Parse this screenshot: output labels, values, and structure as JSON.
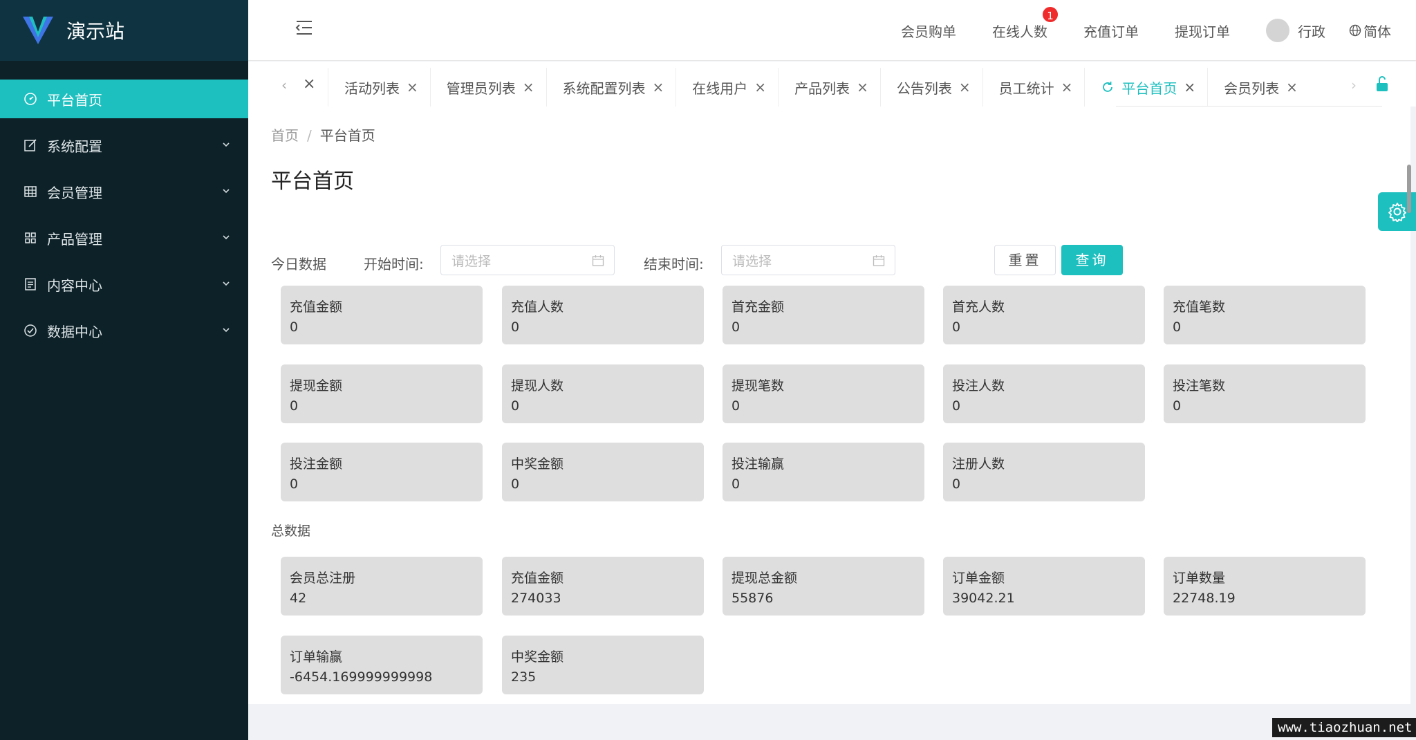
{
  "app": {
    "title": "演示站"
  },
  "sidebar": {
    "items": [
      {
        "label": "平台首页",
        "icon": "dashboard-icon",
        "active": true
      },
      {
        "label": "系统配置",
        "icon": "edit-icon"
      },
      {
        "label": "会员管理",
        "icon": "table-icon"
      },
      {
        "label": "产品管理",
        "icon": "grid-icon"
      },
      {
        "label": "内容中心",
        "icon": "document-icon"
      },
      {
        "label": "数据中心",
        "icon": "check-circle-icon"
      }
    ]
  },
  "header": {
    "links": [
      "会员购单",
      "在线人数",
      "充值订单",
      "提现订单"
    ],
    "online_badge": "1",
    "user_name": "行政",
    "language": "简体"
  },
  "tabs": {
    "items": [
      {
        "label": "活动列表"
      },
      {
        "label": "管理员列表"
      },
      {
        "label": "系统配置列表"
      },
      {
        "label": "在线用户"
      },
      {
        "label": "产品列表"
      },
      {
        "label": "公告列表"
      },
      {
        "label": "员工统计"
      },
      {
        "label": "平台首页",
        "active": true
      },
      {
        "label": "会员列表"
      }
    ],
    "close_glyph": "×"
  },
  "breadcrumb": {
    "home": "首页",
    "separator": "/",
    "current": "平台首页"
  },
  "page_title": "平台首页",
  "filter": {
    "today_label": "今日数据",
    "start_label": "开始时间:",
    "start_placeholder": "请选择",
    "end_label": "结束时间:",
    "end_placeholder": "请选择",
    "reset_label": "重置",
    "query_label": "查询"
  },
  "today_stats": [
    {
      "label": "充值金额",
      "value": "0"
    },
    {
      "label": "充值人数",
      "value": "0"
    },
    {
      "label": "首充金额",
      "value": "0"
    },
    {
      "label": "首充人数",
      "value": "0"
    },
    {
      "label": "充值笔数",
      "value": "0"
    },
    {
      "label": "提现金额",
      "value": "0"
    },
    {
      "label": "提现人数",
      "value": "0"
    },
    {
      "label": "提现笔数",
      "value": "0"
    },
    {
      "label": "投注人数",
      "value": "0"
    },
    {
      "label": "投注笔数",
      "value": "0"
    },
    {
      "label": "投注金额",
      "value": "0"
    },
    {
      "label": "中奖金额",
      "value": "0"
    },
    {
      "label": "投注输赢",
      "value": "0"
    },
    {
      "label": "注册人数",
      "value": "0"
    }
  ],
  "total_label": "总数据",
  "total_stats": [
    {
      "label": "会员总注册",
      "value": "42"
    },
    {
      "label": "充值金额",
      "value": "274033"
    },
    {
      "label": "提现总金额",
      "value": "55876"
    },
    {
      "label": "订单金额",
      "value": "39042.21"
    },
    {
      "label": "订单数量",
      "value": "22748.19"
    },
    {
      "label": "订单输赢",
      "value": "-6454.169999999998"
    },
    {
      "label": "中奖金额",
      "value": "235"
    }
  ],
  "watermark": "www.tiaozhuan.net",
  "colors": {
    "sidebar_bg": "#0d2128",
    "logo_bg": "#0f3340",
    "accent": "#1ebfbf",
    "card_bg": "#dedede",
    "badge": "#f02b2b"
  }
}
